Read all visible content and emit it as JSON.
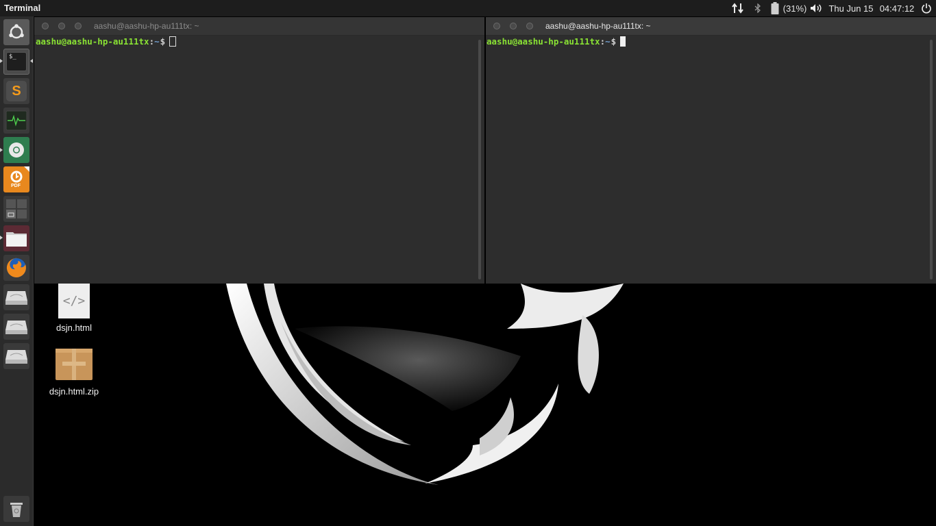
{
  "top_panel": {
    "app_title": "Terminal",
    "battery_text": "(31%)",
    "date": "Thu Jun 15",
    "time": "04:47:12",
    "icons": [
      "network-arrows-icon",
      "bluetooth-icon",
      "battery-icon",
      "volume-icon",
      "power-icon"
    ]
  },
  "launcher": {
    "items": [
      {
        "name": "dash-home",
        "icon": "ubuntu-logo-icon"
      },
      {
        "name": "terminal",
        "icon": "terminal-icon",
        "label": "$_"
      },
      {
        "name": "sublime-text",
        "icon": "sublime-text-icon",
        "label": "S"
      },
      {
        "name": "system-monitor",
        "icon": "system-monitor-icon"
      },
      {
        "name": "chrome",
        "icon": "chrome-icon"
      },
      {
        "name": "foxit-pdf",
        "icon": "pdf-reader-icon",
        "label": "PDF"
      },
      {
        "name": "workspace-switcher",
        "icon": "workspace-switcher-icon"
      },
      {
        "name": "files",
        "icon": "folder-icon"
      },
      {
        "name": "firefox",
        "icon": "firefox-icon"
      },
      {
        "name": "drive-1",
        "icon": "drive-icon"
      },
      {
        "name": "drive-2",
        "icon": "drive-icon"
      },
      {
        "name": "drive-3",
        "icon": "drive-icon"
      }
    ],
    "trash_icon": "trash-icon"
  },
  "terminals": [
    {
      "title": "aashu@aashu-hp-au111tx: ~",
      "prompt_user": "aashu@aashu-hp-au111tx",
      "prompt_sep": ":",
      "prompt_path": "~",
      "prompt_symbol": "$",
      "focused": false
    },
    {
      "title": "aashu@aashu-hp-au111tx: ~",
      "prompt_user": "aashu@aashu-hp-au111tx",
      "prompt_sep": ":",
      "prompt_path": "~",
      "prompt_symbol": "$",
      "focused": true
    }
  ],
  "desktop": {
    "files": [
      {
        "label": "dsjn.html",
        "icon": "html-file-icon",
        "glyph": "</>"
      },
      {
        "label": "dsjn.html.zip",
        "icon": "archive-icon"
      }
    ]
  },
  "colors": {
    "prompt_user": "#8ae234",
    "prompt_path": "#729fcf",
    "terminal_bg": "#2d2d2d",
    "panel_bg": "#1d1d1d",
    "launcher_bg": "#2b2b2b"
  }
}
